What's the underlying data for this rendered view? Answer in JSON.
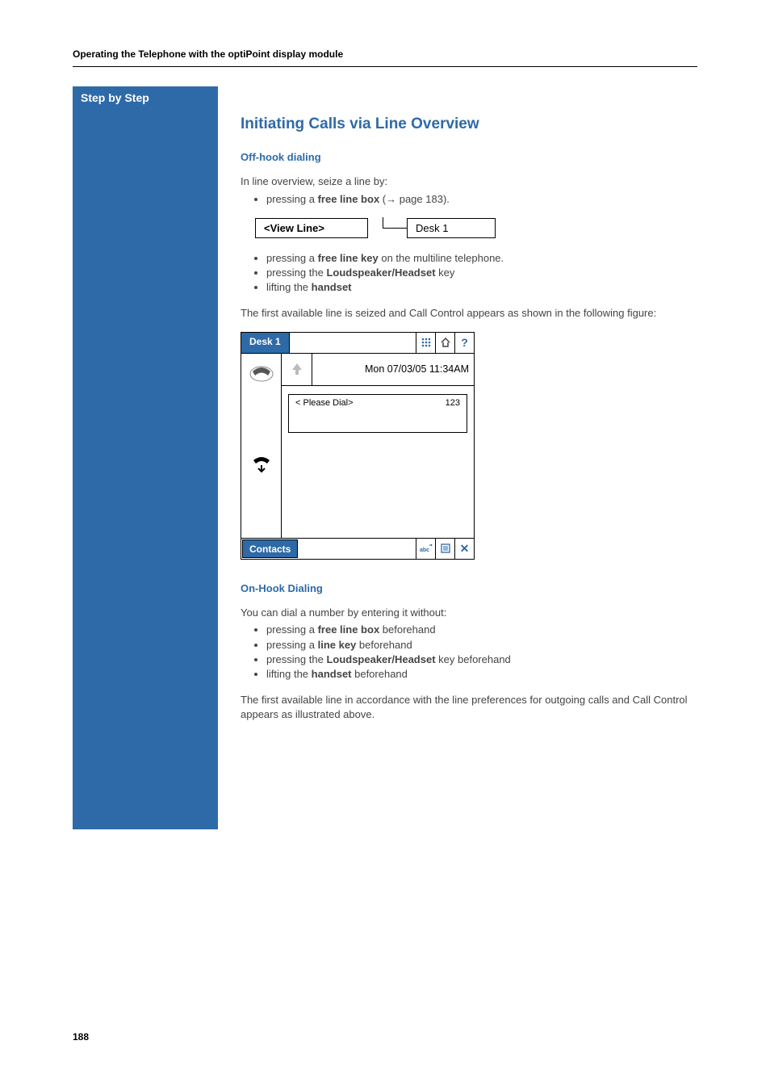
{
  "runningHeader": "Operating the Telephone with the optiPoint display module",
  "sidebarTitle": "Step by Step",
  "section": {
    "title": "Initiating Calls via Line Overview",
    "offHook": {
      "heading": "Off-hook dialing",
      "intro": "In line overview, seize a line by:",
      "firstBullet_prefix": "pressing a ",
      "firstBullet_bold": "free line box",
      "firstBullet_suffix": " (→ page 183).",
      "viewLineLabel": "<View Line>",
      "deskLabel": "Desk 1",
      "bullet2_prefix": "pressing a ",
      "bullet2_bold": "free line key",
      "bullet2_suffix": " on the multiline telephone.",
      "bullet3_prefix": "pressing the ",
      "bullet3_bold": "Loudspeaker/Headset",
      "bullet3_suffix": " key",
      "bullet4_prefix": "lifting the ",
      "bullet4_bold": "handset",
      "result": "The first available line is seized and Call Control appears as shown in the following figure:"
    },
    "display": {
      "tab": "Desk 1",
      "timestamp": "Mon 07/03/05 11:34AM",
      "dialPrompt": "< Please Dial>",
      "dialNumber": "123",
      "contacts": "Contacts",
      "icons": {
        "keypad": "keypad",
        "home": "home",
        "help": "?",
        "abc": "abc",
        "list": "list",
        "close": "✕"
      }
    },
    "onHook": {
      "heading": "On-Hook Dialing",
      "intro": "You can dial a number by entering it without:",
      "b1_prefix": "pressing a ",
      "b1_bold": "free line box",
      "b1_suffix": " beforehand",
      "b2_prefix": "pressing a ",
      "b2_bold": "line key",
      "b2_suffix": " beforehand",
      "b3_prefix": "pressing the ",
      "b3_bold": "Loudspeaker/Headset",
      "b3_suffix": " key beforehand",
      "b4_prefix": "lifting the ",
      "b4_bold": "handset",
      "b4_suffix": "  beforehand",
      "result": "The first available line in accordance with the line preferences for outgoing calls and Call Control appears as illustrated above."
    }
  },
  "pageNumber": "188"
}
